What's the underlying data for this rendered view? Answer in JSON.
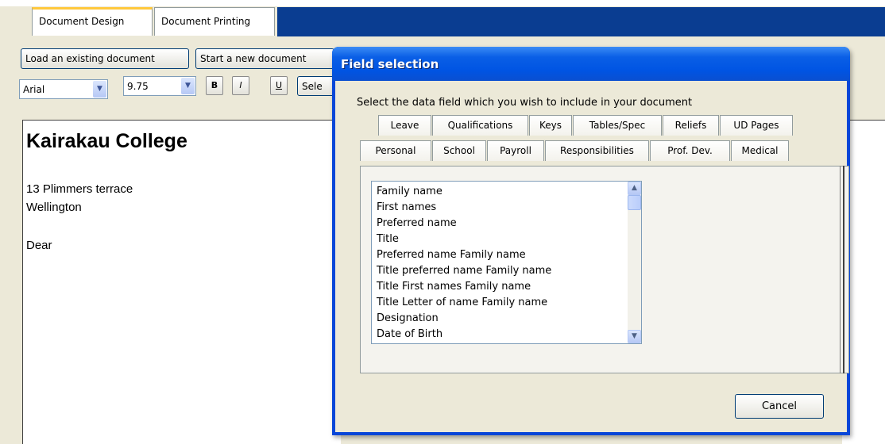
{
  "tabs": [
    "Document Design",
    "Document Printing"
  ],
  "toolbar": {
    "load_label": "Load an existing document",
    "new_label": "Start a new document",
    "select_label": "Sele",
    "font_value": "Arial",
    "size_value": "9.75",
    "bold_label": "B",
    "italic_label": "I",
    "underline_label": "U"
  },
  "document": {
    "heading": "Kairakau College",
    "line1": "13 Plimmers terrace",
    "line2": "Wellington",
    "line3": "Dear"
  },
  "dialog": {
    "title": "Field selection",
    "prompt": "Select the data field which you wish to include in your document",
    "tabs_row1": [
      "Leave",
      "Qualifications",
      "Keys",
      "Tables/Spec",
      "Reliefs",
      "UD Pages"
    ],
    "tabs_row2": [
      "Personal",
      "School",
      "Payroll",
      "Responsibilities",
      "Prof. Dev.",
      "Medical"
    ],
    "fields": [
      "Family name",
      "First names",
      "Preferred name",
      "Title",
      "Preferred name Family name",
      "Title preferred name Family name",
      "Title First names Family name",
      "Title Letter of name Family name",
      "Designation",
      "Date of Birth"
    ],
    "cancel_label": "Cancel"
  }
}
